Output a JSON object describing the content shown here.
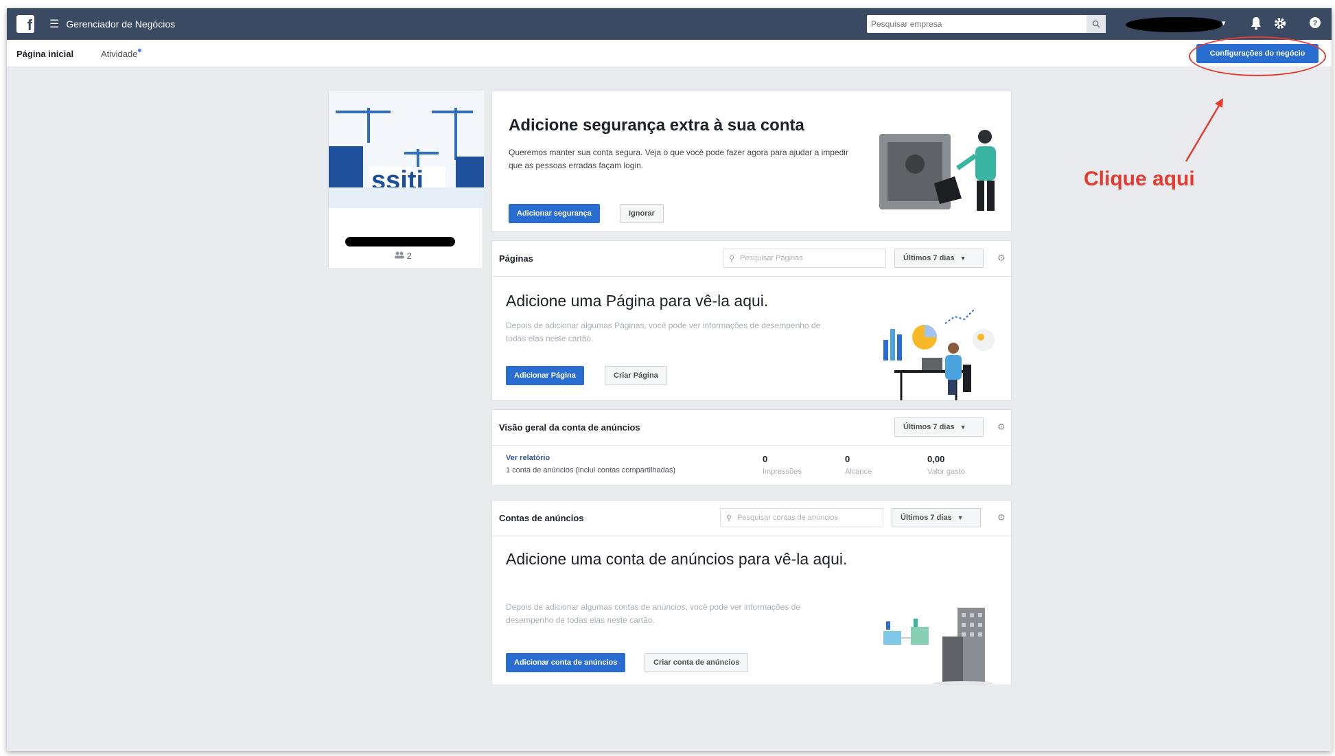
{
  "topbar": {
    "app_title": "Gerenciador de Negócios",
    "search_placeholder": "Pesquisar empresa"
  },
  "subnav": {
    "tab_home": "Página inicial",
    "tab_activity": "Atividade",
    "business_settings_label": "Configurações do negócio"
  },
  "annotation": {
    "label": "Clique aqui",
    "color": "#e53b2f"
  },
  "profile": {
    "member_count": "2"
  },
  "security_card": {
    "title": "Adicione segurança extra à sua conta",
    "description": "Queremos manter sua conta segura. Veja o que você pode fazer agora para ajudar a impedir que as pessoas erradas façam login.",
    "primary_label": "Adicionar segurança",
    "secondary_label": "Ignorar"
  },
  "pages_card": {
    "header": "Páginas",
    "search_placeholder": "Pesquisar Páginas",
    "period": "Últimos 7 dias",
    "title": "Adicione uma Página para vê-la aqui.",
    "description": "Depois de adicionar algumas Páginas, você pode ver informações de desempenho de todas elas neste cartão.",
    "primary_label": "Adicionar Página",
    "secondary_label": "Criar Página"
  },
  "overview_card": {
    "header": "Visão geral da conta de anúncios",
    "period": "Últimos 7 dias",
    "report_link": "Ver relatório",
    "accounts_text": "1 conta de anúncios (inclui contas compartilhadas)",
    "stats": [
      {
        "value": "0",
        "label": "Impressões"
      },
      {
        "value": "0",
        "label": "Alcance"
      },
      {
        "value": "0,00",
        "label": "Valor gasto"
      }
    ]
  },
  "ad_accounts_card": {
    "header": "Contas de anúncios",
    "search_placeholder": "Pesquisar contas de anúncios",
    "period": "Últimos 7 dias",
    "title": "Adicione uma conta de anúncios para vê-la aqui.",
    "description": "Depois de adicionar algumas contas de anúncios, você pode ver informações de desempenho de todas elas neste cartão.",
    "primary_label": "Adicionar conta de anúncios",
    "secondary_label": "Criar conta de anúncios"
  },
  "colors": {
    "topbar": "#3b4a63",
    "primary_button": "#2a6dd0",
    "background": "#e9ebee"
  }
}
